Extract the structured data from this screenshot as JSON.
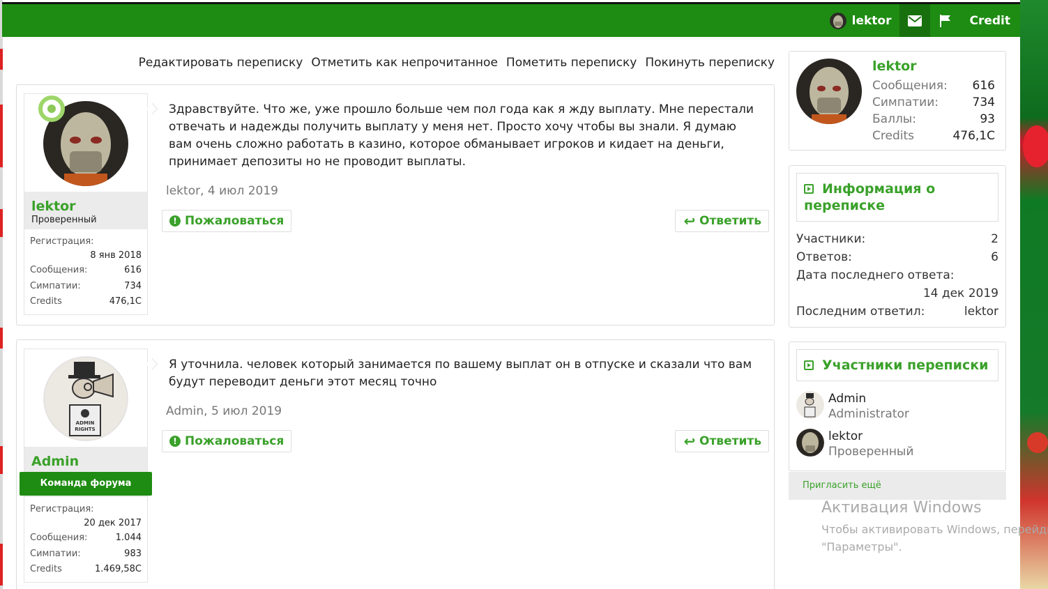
{
  "topbar": {
    "username": "lektor",
    "credit_label": "Credit",
    "icons": [
      "envelope-icon",
      "flag-icon"
    ]
  },
  "actions": {
    "edit": "Редактировать переписку",
    "mark_unread": "Отметить как непрочитанное",
    "star": "Пометить переписку",
    "leave": "Покинуть переписку"
  },
  "messages": [
    {
      "username": "lektor",
      "user_title": "Проверенный",
      "stats": {
        "reg_label": "Регистрация:",
        "reg_value": "8 янв 2018",
        "posts_label": "Сообщения:",
        "posts_value": "616",
        "likes_label": "Симпатии:",
        "likes_value": "734",
        "credits_label": "Credits",
        "credits_value": "476,1C"
      },
      "text": "Здравствуйте. Что же, уже прошло больше чем пол года как я жду выплату. Мне перестали отвечать и надежды получить выплату у меня нет. Просто хочу чтобы вы знали. Я думаю вам очень сложно работать в казино, которое обманывает игроков и кидает на деньги, принимает депозиты но не проводит выплаты.",
      "meta": "lektor, 4 июл 2019",
      "report_label": "Пожаловаться",
      "reply_label": "Ответить"
    },
    {
      "username": "Admin",
      "user_title": "Команда форума",
      "stats": {
        "reg_label": "Регистрация:",
        "reg_value": "20 дек 2017",
        "posts_label": "Сообщения:",
        "posts_value": "1.044",
        "likes_label": "Симпатии:",
        "likes_value": "983",
        "credits_label": "Credits",
        "credits_value": "1.469,58C"
      },
      "text": "Я уточнила. человек который занимается по вашему выплат он в отпуске и сказали что вам будут переводит деньги этот месяц точно",
      "meta": "Admin, 5 июл 2019",
      "report_label": "Пожаловаться",
      "reply_label": "Ответить"
    }
  ],
  "sidebar": {
    "profile": {
      "username": "lektor",
      "posts_label": "Сообщения:",
      "posts_value": "616",
      "likes_label": "Симпатии:",
      "likes_value": "734",
      "points_label": "Баллы:",
      "points_value": "93",
      "credits_label": "Credits",
      "credits_value": "476,1C"
    },
    "info": {
      "title": "Информация о переписке",
      "participants_label": "Участники:",
      "participants_value": "2",
      "replies_label": "Ответов:",
      "replies_value": "6",
      "last_date_label": "Дата последнего ответа:",
      "last_date_value": "14 дек 2019",
      "last_by_label": "Последним ответил:",
      "last_by_value": "lektor"
    },
    "participants": {
      "title": "Участники переписки",
      "list": [
        {
          "name": "Admin",
          "title": "Administrator"
        },
        {
          "name": "lektor",
          "title": "Проверенный"
        }
      ]
    },
    "invite_label": "Пригласить ещё"
  },
  "watermark": {
    "title": "Активация Windows",
    "line1": "Чтобы активировать Windows, перейдите",
    "line2": "\"Параметры\"."
  },
  "colors": {
    "brand_green": "#1e8c12",
    "link_green": "#3aa12a"
  }
}
